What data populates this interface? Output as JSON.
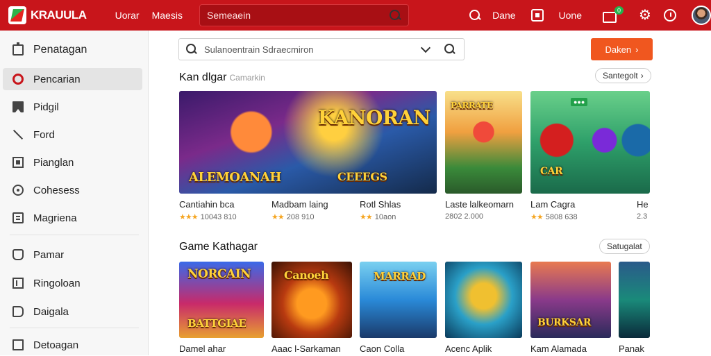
{
  "header": {
    "brand": "KRAUULA",
    "links": [
      "Uorar",
      "Maesis"
    ],
    "search_placeholder": "Semeaein",
    "right_items": [
      "Dane",
      "Uone"
    ],
    "cart_badge": "0"
  },
  "sidebar": {
    "items": [
      {
        "label": "Penatagan",
        "icon": "home-icon"
      },
      {
        "label": "Pencarian",
        "icon": "target-icon"
      },
      {
        "label": "Pidgil",
        "icon": "bookmark-icon"
      },
      {
        "label": "Ford",
        "icon": "slash-icon"
      },
      {
        "label": "Pianglan",
        "icon": "square-icon"
      },
      {
        "label": "Cohesess",
        "icon": "chat-icon"
      },
      {
        "label": "Magriena",
        "icon": "magazine-icon"
      },
      {
        "label": "Pamar",
        "icon": "award-icon"
      },
      {
        "label": "Ringoloan",
        "icon": "list-icon"
      },
      {
        "label": "Daigala",
        "icon": "tag-icon"
      },
      {
        "label": "Detoagan",
        "icon": "book-icon"
      }
    ]
  },
  "main": {
    "search_placeholder": "Sulanoentrain Sdraecmiron",
    "cta_label": "Daken",
    "section1": {
      "title": "Kan dlgar",
      "subtitle": "Camarkin",
      "pill": "Santegolt",
      "cards": [
        {
          "art_text": "KANORAN",
          "art_sub": "ALEMOANAH",
          "name": "Cantiahin bca",
          "stars": "★★★",
          "meta": "10043 810"
        },
        {
          "art_text": "",
          "art_sub": "CEEEGS",
          "name": "Madbam laing",
          "stars": "★★",
          "meta": "208 910"
        },
        {
          "art_text": "",
          "art_sub": "",
          "name": "Rotl Shlas",
          "stars": "★★",
          "meta": "10aon"
        },
        {
          "art_text": "PARRATE",
          "art_sub": "",
          "name": "Laste lalkeomarn",
          "stars": "",
          "meta": "2802 2.000"
        },
        {
          "art_text": "",
          "art_sub": "CAR",
          "name": "Lam Cagra",
          "stars": "★★",
          "meta": "5808 638"
        },
        {
          "art_text": "",
          "art_sub": "",
          "name": "He",
          "stars": "",
          "meta": "2.3"
        }
      ]
    },
    "section2": {
      "title": "Game Kathagar",
      "pill": "Satugalat",
      "cards": [
        {
          "art_text": "NORCAIN",
          "art_sub": "BATTGIAE",
          "name": "Damel ahar"
        },
        {
          "art_text": "Canoeh",
          "art_sub": "",
          "name": "Aaac l-Sarkaman"
        },
        {
          "art_text": "MARRAD",
          "art_sub": "",
          "name": "Caon Colla"
        },
        {
          "art_text": "",
          "art_sub": "",
          "name": "Acenc Aplik"
        },
        {
          "art_text": "",
          "art_sub": "BURKSAR",
          "name": "Kam Alamada"
        },
        {
          "art_text": "",
          "art_sub": "",
          "name": "Panak"
        }
      ]
    }
  }
}
